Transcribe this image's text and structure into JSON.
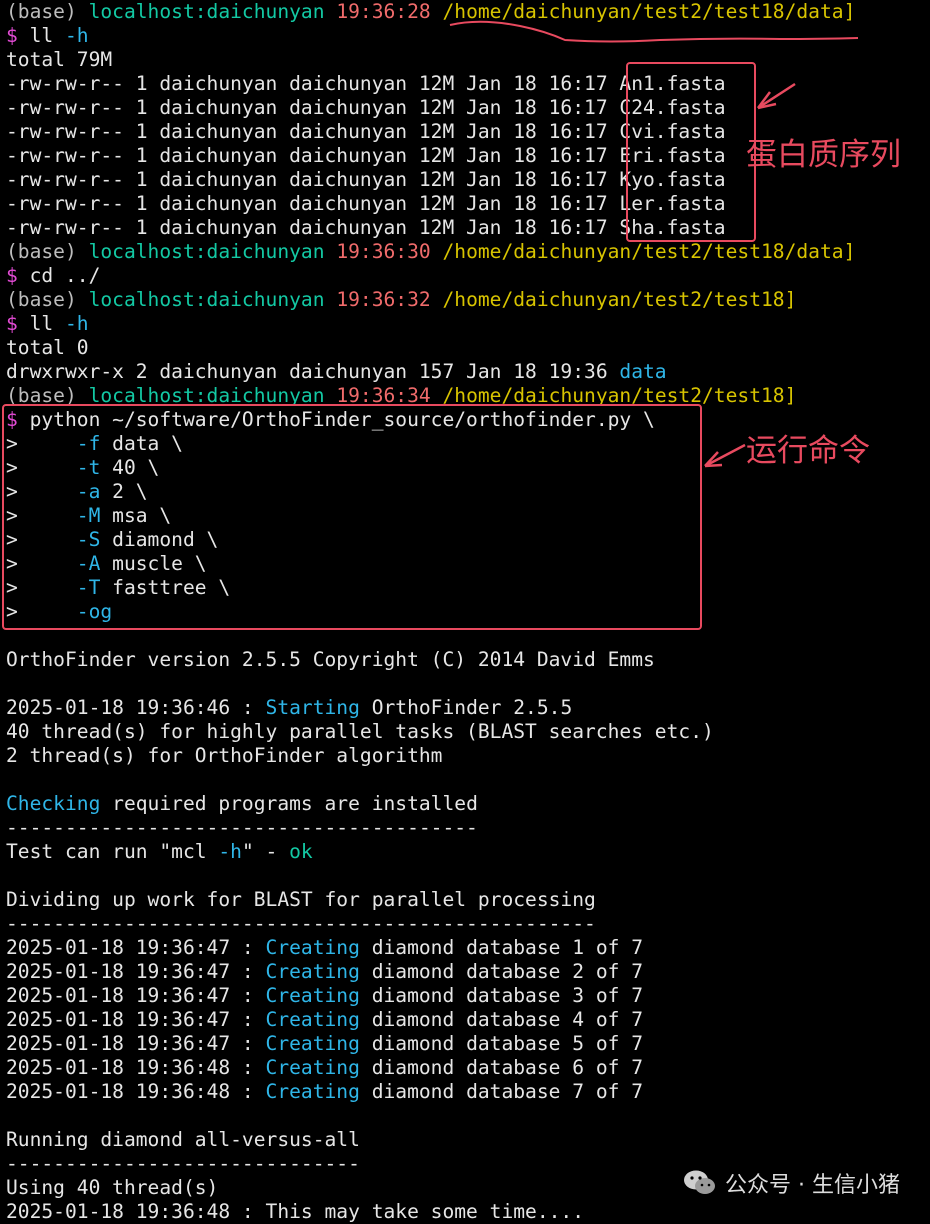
{
  "colors": {
    "prompt_host": "#13c9a4",
    "time": "#f06b6b",
    "path": "#d8c400",
    "keyword_cyan": "#2fb6e8",
    "dollar": "#e34bd5",
    "annotation_red": "#e84a5f"
  },
  "terminal": {
    "prompts": [
      {
        "base": "(base) ",
        "host": "localhost:daichunyan",
        "time": "19:36:28",
        "path": "/home/daichunyan/test2/test18/data]"
      },
      {
        "base": "(base) ",
        "host": "localhost:daichunyan",
        "time": "19:36:30",
        "path": "/home/daichunyan/test2/test18/data]"
      },
      {
        "base": "(base) ",
        "host": "localhost:daichunyan",
        "time": "19:36:32",
        "path": "/home/daichunyan/test2/test18]"
      },
      {
        "base": "(base) ",
        "host": "localhost:daichunyan",
        "time": "19:36:34",
        "path": "/home/daichunyan/test2/test18]"
      }
    ],
    "cmd_ll": {
      "dollar": "$ ",
      "cmd": "ll ",
      "flag": "-h"
    },
    "total_1": "total 79M",
    "files": [
      {
        "perm": "-rw-rw-r-- 1 daichunyan daichunyan 12M Jan 18 16:17 ",
        "name": "An1.fasta"
      },
      {
        "perm": "-rw-rw-r-- 1 daichunyan daichunyan 12M Jan 18 16:17 ",
        "name": "C24.fasta"
      },
      {
        "perm": "-rw-rw-r-- 1 daichunyan daichunyan 12M Jan 18 16:17 ",
        "name": "Cvi.fasta"
      },
      {
        "perm": "-rw-rw-r-- 1 daichunyan daichunyan 12M Jan 18 16:17 ",
        "name": "Eri.fasta"
      },
      {
        "perm": "-rw-rw-r-- 1 daichunyan daichunyan 12M Jan 18 16:17 ",
        "name": "Kyo.fasta"
      },
      {
        "perm": "-rw-rw-r-- 1 daichunyan daichunyan 12M Jan 18 16:17 ",
        "name": "Ler.fasta"
      },
      {
        "perm": "-rw-rw-r-- 1 daichunyan daichunyan 12M Jan 18 16:17 ",
        "name": "Sha.fasta"
      }
    ],
    "cmd_cd": {
      "dollar": "$ ",
      "cmd": "cd ../"
    },
    "total_2": "total 0",
    "dir_line": {
      "perm": "drwxrwxr-x 2 daichunyan daichunyan 157 Jan 18 19:36 ",
      "name": "data"
    },
    "python_cmd": {
      "dollar": "$ ",
      "cmd": "python ~/software/OrthoFinder_source/orthofinder.py \\"
    },
    "python_args": [
      {
        "prefix": ">     ",
        "flag": "-f",
        "value": " data \\"
      },
      {
        "prefix": ">     ",
        "flag": "-t",
        "value": " 40 \\"
      },
      {
        "prefix": ">     ",
        "flag": "-a",
        "value": " 2 \\"
      },
      {
        "prefix": ">     ",
        "flag": "-M",
        "value": " msa \\"
      },
      {
        "prefix": ">     ",
        "flag": "-S",
        "value": " diamond \\"
      },
      {
        "prefix": ">     ",
        "flag": "-A",
        "value": " muscle \\"
      },
      {
        "prefix": ">     ",
        "flag": "-T",
        "value": " fasttree \\"
      },
      {
        "prefix": ">     ",
        "flag": "-og",
        "value": ""
      }
    ],
    "version_line": "OrthoFinder version 2.5.5 Copyright (C) 2014 David Emms",
    "starting": {
      "ts": "2025-01-18 19:36:46 : ",
      "kw": "Starting",
      "rest": " OrthoFinder 2.5.5"
    },
    "threads_1": "40 thread(s) for highly parallel tasks (BLAST searches etc.)",
    "threads_2": "2 thread(s) for OrthoFinder algorithm",
    "checking": {
      "kw": "Checking",
      "rest": " required programs are installed"
    },
    "dash_1": "----------------------------------------",
    "test_line": {
      "pre": "Test can run \"mcl ",
      "flag": "-h",
      "mid": "\" - ",
      "ok": "ok"
    },
    "dividing": "Dividing up work for BLAST for parallel processing",
    "dash_2": "--------------------------------------------------",
    "creating": [
      {
        "ts": "2025-01-18 19:36:47 : ",
        "kw": "Creating",
        "rest": " diamond database 1 of 7"
      },
      {
        "ts": "2025-01-18 19:36:47 : ",
        "kw": "Creating",
        "rest": " diamond database 2 of 7"
      },
      {
        "ts": "2025-01-18 19:36:47 : ",
        "kw": "Creating",
        "rest": " diamond database 3 of 7"
      },
      {
        "ts": "2025-01-18 19:36:47 : ",
        "kw": "Creating",
        "rest": " diamond database 4 of 7"
      },
      {
        "ts": "2025-01-18 19:36:47 : ",
        "kw": "Creating",
        "rest": " diamond database 5 of 7"
      },
      {
        "ts": "2025-01-18 19:36:48 : ",
        "kw": "Creating",
        "rest": " diamond database 6 of 7"
      },
      {
        "ts": "2025-01-18 19:36:48 : ",
        "kw": "Creating",
        "rest": " diamond database 7 of 7"
      }
    ],
    "running": "Running diamond all-versus-all",
    "dash_3": "------------------------------",
    "using": "Using 40 thread(s)",
    "last_line": "2025-01-18 19:36:48 : This may take some time...."
  },
  "annotations": {
    "protein_label": "蛋白质序列",
    "command_label": "运行命令"
  },
  "watermark": {
    "icon": "wechat-icon",
    "text": "公众号 · 生信小猪"
  }
}
